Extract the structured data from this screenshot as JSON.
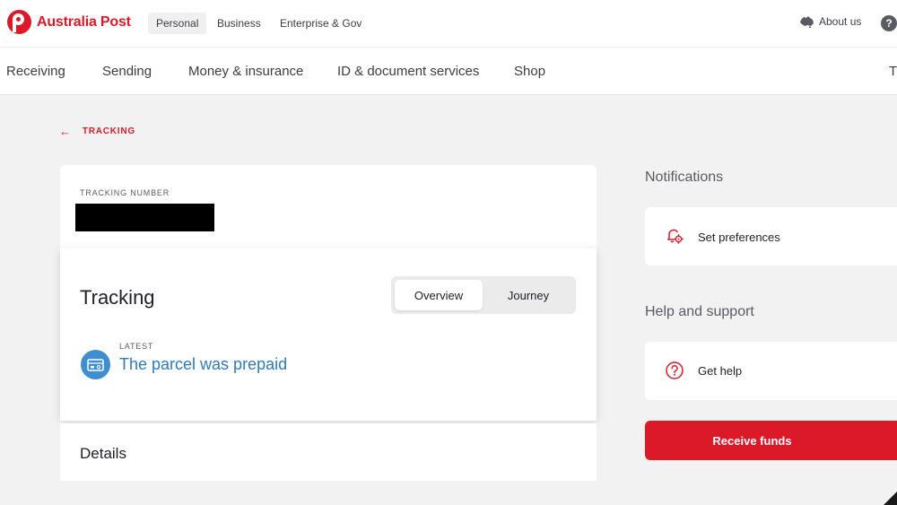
{
  "brand": {
    "name": "Australia Post",
    "color": "#dc1928"
  },
  "topbar": {
    "segments": [
      "Personal",
      "Business",
      "Enterprise & Gov"
    ],
    "active_segment": "Personal",
    "about_label": "About us",
    "help_glyph": "?"
  },
  "nav": {
    "items": [
      "Receiving",
      "Sending",
      "Money & insurance",
      "ID & document services",
      "Shop",
      "T"
    ]
  },
  "back_link": {
    "label": "TRACKING"
  },
  "tracking_card": {
    "number_label": "TRACKING NUMBER",
    "number_value": "",
    "title": "Tracking",
    "tabs": [
      "Overview",
      "Journey"
    ],
    "active_tab": "Overview",
    "latest_label": "LATEST",
    "latest_status": "The parcel was prepaid",
    "details_title": "Details"
  },
  "sidebar": {
    "notifications_heading": "Notifications",
    "set_preferences_label": "Set preferences",
    "help_heading": "Help and support",
    "get_help_label": "Get help",
    "receive_funds_label": "Receive funds"
  },
  "icons": {
    "about": "australia-map-icon",
    "help": "help-circle-icon",
    "back": "arrow-left-icon",
    "status": "prepaid-card-icon",
    "preferences": "bell-gear-icon",
    "get_help": "question-circle-icon"
  },
  "colors": {
    "accent": "#dc1928",
    "status_blue": "#2f7ab9",
    "page_bg": "#f2f2f2"
  }
}
